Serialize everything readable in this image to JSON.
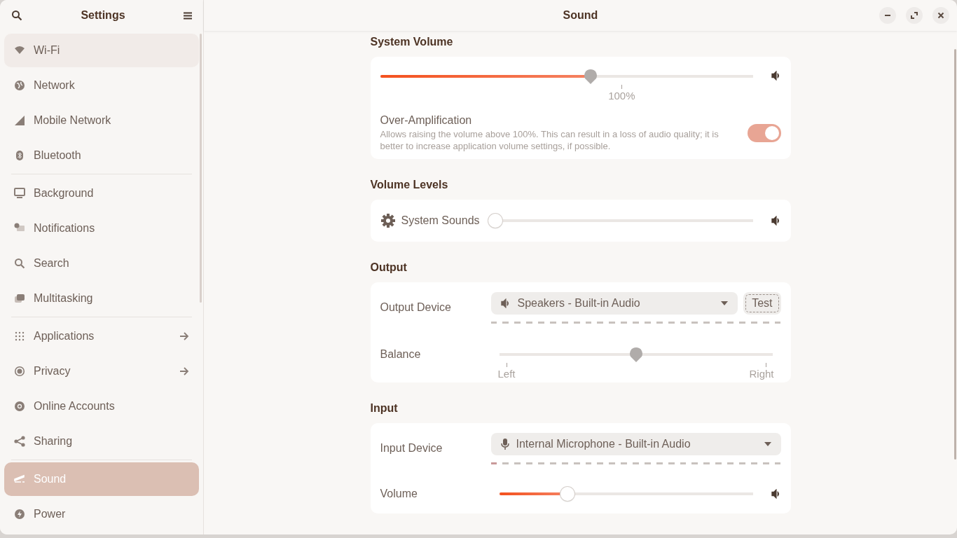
{
  "sidebar": {
    "title": "Settings",
    "groups": [
      [
        {
          "label": "Wi-Fi",
          "selected": false,
          "hovered": true,
          "arrow": false
        },
        {
          "label": "Network",
          "selected": false,
          "hovered": false,
          "arrow": false
        },
        {
          "label": "Mobile Network",
          "selected": false,
          "hovered": false,
          "arrow": false
        },
        {
          "label": "Bluetooth",
          "selected": false,
          "hovered": false,
          "arrow": false
        }
      ],
      [
        {
          "label": "Background",
          "selected": false,
          "hovered": false,
          "arrow": false
        },
        {
          "label": "Notifications",
          "selected": false,
          "hovered": false,
          "arrow": false
        },
        {
          "label": "Search",
          "selected": false,
          "hovered": false,
          "arrow": false
        },
        {
          "label": "Multitasking",
          "selected": false,
          "hovered": false,
          "arrow": false
        }
      ],
      [
        {
          "label": "Applications",
          "selected": false,
          "hovered": false,
          "arrow": true
        },
        {
          "label": "Privacy",
          "selected": false,
          "hovered": false,
          "arrow": true
        },
        {
          "label": "Online Accounts",
          "selected": false,
          "hovered": false,
          "arrow": false
        },
        {
          "label": "Sharing",
          "selected": false,
          "hovered": false,
          "arrow": false
        }
      ],
      [
        {
          "label": "Sound",
          "selected": true,
          "hovered": false,
          "arrow": false
        },
        {
          "label": "Power",
          "selected": false,
          "hovered": false,
          "arrow": false
        }
      ]
    ]
  },
  "window": {
    "title": "Sound"
  },
  "system_volume": {
    "heading": "System Volume",
    "slider": {
      "level": 0.567,
      "marks": [
        "100%"
      ]
    },
    "over_amplification": {
      "title": "Over-Amplification",
      "description": "Allows raising the volume above 100%. This can result in a loss of audio quality; it is better to increase application volume settings, if possible.",
      "on": true
    }
  },
  "volume_levels": {
    "heading": "Volume Levels",
    "rows": [
      {
        "label": "System Sounds",
        "level": 0
      }
    ]
  },
  "output": {
    "heading": "Output",
    "device_label": "Output Device",
    "device": "Speakers - Built-in Audio",
    "test_button": {
      "label": "Test",
      "focused": true
    },
    "meter": {
      "level": 0
    },
    "balance": {
      "label": "Balance",
      "level": 0.5,
      "marks": [
        "Left",
        "Right"
      ]
    }
  },
  "input": {
    "heading": "Input",
    "device_label": "Input Device",
    "device": "Internal Microphone - Built-in Audio",
    "meter": {
      "level": 0.04
    },
    "volume": {
      "label": "Volume",
      "level": 0.257
    }
  }
}
